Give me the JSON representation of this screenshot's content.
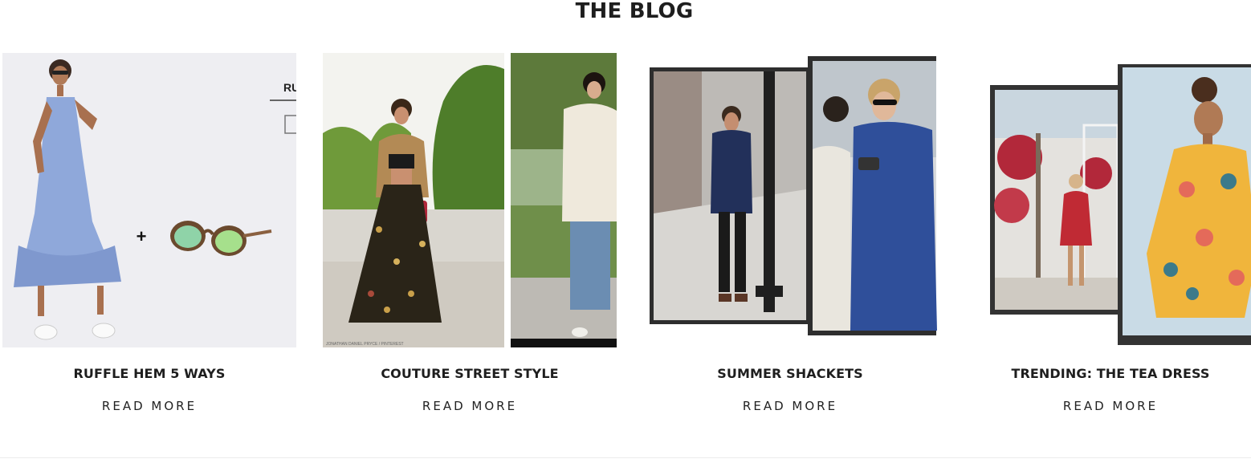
{
  "section": {
    "title": "THE BLOG"
  },
  "posts": [
    {
      "title": "RUFFLE HEM 5 WAYS",
      "cta": "READ MORE",
      "thumb_overlay_text": "RU"
    },
    {
      "title": "COUTURE STREET STYLE",
      "cta": "READ MORE",
      "thumb_watermark": "JONATHAN DANIEL PRYCE / PINTEREST"
    },
    {
      "title": "SUMMER SHACKETS",
      "cta": "READ MORE"
    },
    {
      "title": "TRENDING: THE TEA DRESS",
      "cta": "READ MORE"
    }
  ],
  "colors": {
    "text": "#1e1e1e",
    "background": "#ffffff",
    "divider": "#ececec"
  }
}
